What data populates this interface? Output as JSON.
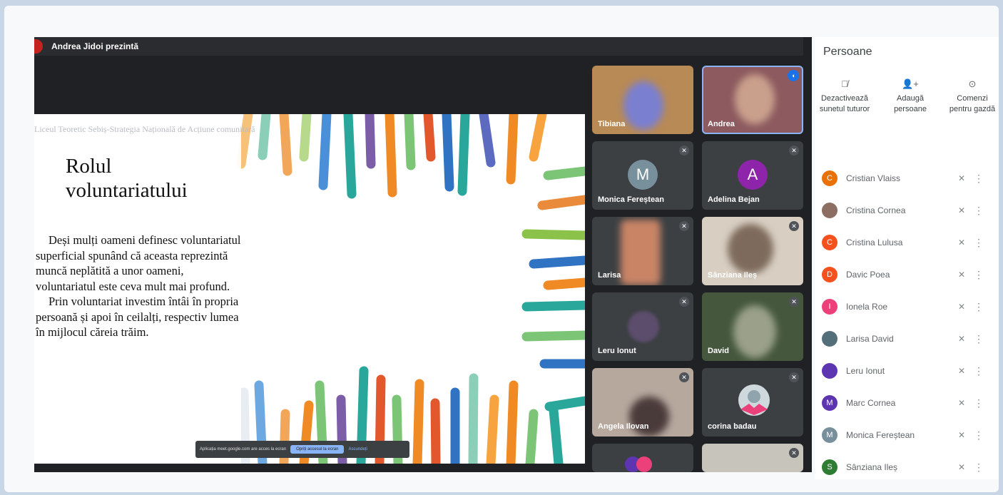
{
  "presenter_bar": {
    "text": "Andrea Jidoi prezintă"
  },
  "slide": {
    "header": "Liceul Teoretic Sebiș-Strategia Națională de Acțiune comunitară",
    "title": "Rolul voluntariatului",
    "paragraph1": "Deși mulți oameni definesc voluntariatul superficial spunând că aceasta reprezintă muncă neplătită a unor oameni, voluntariatul este ceva mult mai profund.",
    "paragraph2": "Prin voluntariat investim întâi în propria persoană și apoi în ceilalți, respectiv lumea în mijlocul căreia trăim."
  },
  "share_notice": {
    "text": "Aplicația meet.google.com are acces la ecran",
    "button": "Opriți accesul la ecran",
    "link": "Ascundeți"
  },
  "tiles": [
    {
      "name": "Tibiana",
      "type": "video"
    },
    {
      "name": "Andrea",
      "type": "video",
      "speaking": true
    },
    {
      "name": "Monica Fereștean",
      "type": "avatar",
      "initial": "M",
      "color": "#78909c"
    },
    {
      "name": "Adelina Bejan",
      "type": "avatar",
      "initial": "A",
      "color": "#8e24aa"
    },
    {
      "name": "Larisa",
      "type": "video"
    },
    {
      "name": "Sânziana Ileș",
      "type": "video"
    },
    {
      "name": "Leru Ionut",
      "type": "video"
    },
    {
      "name": "David",
      "type": "video"
    },
    {
      "name": "Angela Ilovan",
      "type": "video"
    },
    {
      "name": "corina badau",
      "type": "avatar-image"
    }
  ],
  "people_panel": {
    "title": "Persoane",
    "actions": [
      {
        "icon": "mic-off-icon",
        "label": "Dezactivează sunetul tuturor"
      },
      {
        "icon": "add-person-icon",
        "label": "Adaugă persoane"
      },
      {
        "icon": "toggle-icon",
        "label": "Comenzi pentru gazdă"
      }
    ],
    "people": [
      {
        "name": "Cristian Vlaiss",
        "initial": "C",
        "color": "#e8710a"
      },
      {
        "name": "Cristina Cornea",
        "initial": "",
        "color": "#8d6e63"
      },
      {
        "name": "Cristina Lulusa",
        "initial": "C",
        "color": "#f4511e"
      },
      {
        "name": "Davic Poea",
        "initial": "D",
        "color": "#f4511e"
      },
      {
        "name": "Ionela Roe",
        "initial": "I",
        "color": "#ec407a"
      },
      {
        "name": "Larisa David",
        "initial": "",
        "color": "#546e7a"
      },
      {
        "name": "Leru Ionut",
        "initial": "",
        "color": "#5e35b1"
      },
      {
        "name": "Marc Cornea",
        "initial": "M",
        "color": "#5e35b1"
      },
      {
        "name": "Monica Fereștean",
        "initial": "M",
        "color": "#78909c"
      },
      {
        "name": "Sânziana Ileș",
        "initial": "S",
        "color": "#2e7d32"
      }
    ]
  }
}
